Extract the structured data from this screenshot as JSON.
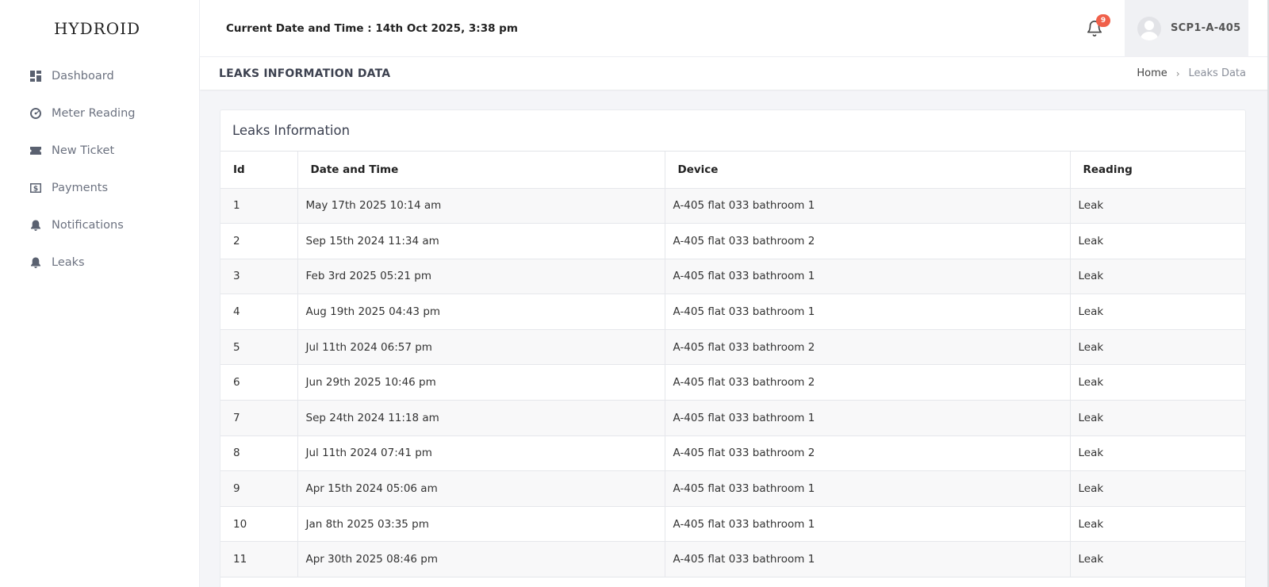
{
  "brand": "HYDROID",
  "sidebar": {
    "items": [
      {
        "label": "Dashboard",
        "icon": "dashboard-icon"
      },
      {
        "label": "Meter Reading",
        "icon": "gauge-icon"
      },
      {
        "label": "New Ticket",
        "icon": "ticket-icon"
      },
      {
        "label": "Payments",
        "icon": "dollar-icon"
      },
      {
        "label": "Notifications",
        "icon": "bell-icon"
      },
      {
        "label": "Leaks",
        "icon": "bell-icon"
      }
    ]
  },
  "header": {
    "datetime": "Current Date and Time : 14th Oct 2025, 3:38 pm",
    "notification_count": "9",
    "username": "SCP1-A-405"
  },
  "page": {
    "title": "LEAKS INFORMATION DATA",
    "breadcrumb_home": "Home",
    "breadcrumb_sep": "›",
    "breadcrumb_current": "Leaks Data"
  },
  "card": {
    "title": "Leaks Information",
    "columns": [
      "Id",
      "Date and Time",
      "Device",
      "Reading"
    ],
    "rows": [
      [
        "1",
        "May 17th 2025 10:14 am",
        "A-405 flat 033 bathroom 1",
        "Leak"
      ],
      [
        "2",
        "Sep 15th 2024 11:34 am",
        "A-405 flat 033 bathroom 2",
        "Leak"
      ],
      [
        "3",
        "Feb 3rd 2025 05:21 pm",
        "A-405 flat 033 bathroom 1",
        "Leak"
      ],
      [
        "4",
        "Aug 19th 2025 04:43 pm",
        "A-405 flat 033 bathroom 1",
        "Leak"
      ],
      [
        "5",
        "Jul 11th 2024 06:57 pm",
        "A-405 flat 033 bathroom 2",
        "Leak"
      ],
      [
        "6",
        "Jun 29th 2025 10:46 pm",
        "A-405 flat 033 bathroom 2",
        "Leak"
      ],
      [
        "7",
        "Sep 24th 2024 11:18 am",
        "A-405 flat 033 bathroom 1",
        "Leak"
      ],
      [
        "8",
        "Jul 11th 2024 07:41 pm",
        "A-405 flat 033 bathroom 2",
        "Leak"
      ],
      [
        "9",
        "Apr 15th 2024 05:06 am",
        "A-405 flat 033 bathroom 1",
        "Leak"
      ],
      [
        "10",
        "Jan 8th 2025 03:35 pm",
        "A-405 flat 033 bathroom 1",
        "Leak"
      ],
      [
        "11",
        "Apr 30th 2025 08:46 pm",
        "A-405 flat 033 bathroom 1",
        "Leak"
      ]
    ]
  },
  "colors": {
    "badge": "#f0604a",
    "sidebar_icon": "#5a6170",
    "background": "#f4f5f8"
  }
}
